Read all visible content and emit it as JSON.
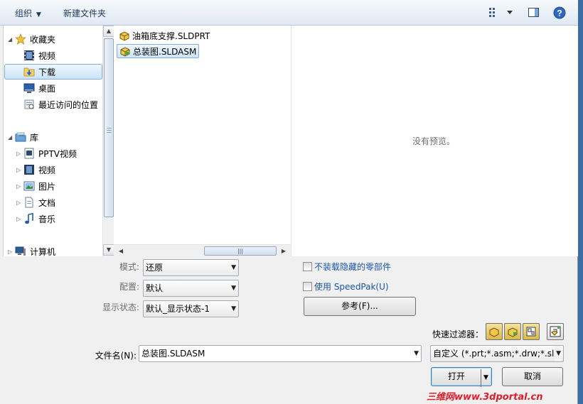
{
  "toolbar": {
    "organize": "组织",
    "new_folder": "新建文件夹"
  },
  "nav": {
    "favorites_label": "收藏夹",
    "favorites": [
      "视频",
      "下载",
      "桌面",
      "最近访问的位置"
    ],
    "library_label": "库",
    "library": [
      "PPTV视频",
      "视频",
      "图片",
      "文档",
      "音乐"
    ],
    "computer_label": "计算机"
  },
  "files": [
    "油箱底支撑.SLDPRT",
    "总装图.SLDASM"
  ],
  "preview": {
    "text": "没有预览。"
  },
  "options": {
    "mode_label": "模式:",
    "mode_value": "还原",
    "config_label": "配置:",
    "config_value": "默认",
    "display_label": "显示状态:",
    "display_value": "默认_显示状态-1",
    "hidden_label": "不装载隐藏的零部件",
    "speedpak_label": "使用 SpeedPak(U)",
    "ref_button": "参考(F)...",
    "quick_filter_label": "快速过滤器："
  },
  "filename": {
    "label": "文件名(N):",
    "value": "总装图.SLDASM",
    "filter_value": "自定义 (*.prt;*.asm;*.drw;*.sld"
  },
  "buttons": {
    "open": "打开",
    "cancel": "取消"
  },
  "watermark": "三维网www.3dportal.cn",
  "colors": {
    "accent": "#1a56a8",
    "watermark": "#e21c2a"
  }
}
